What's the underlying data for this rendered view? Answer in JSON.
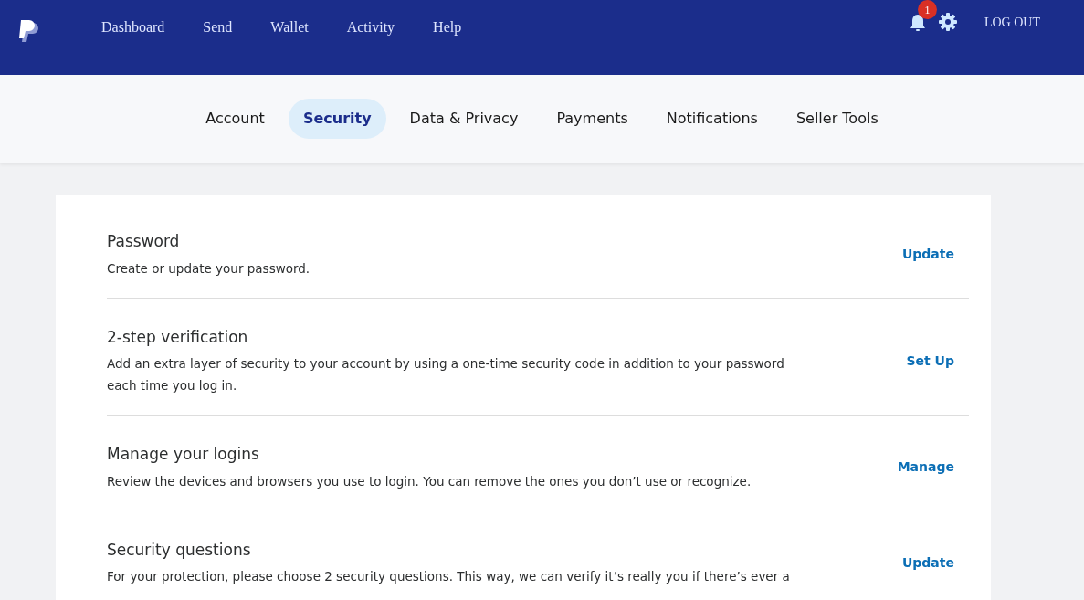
{
  "header": {
    "nav": [
      {
        "label": "Dashboard"
      },
      {
        "label": "Send"
      },
      {
        "label": "Wallet"
      },
      {
        "label": "Activity"
      },
      {
        "label": "Help"
      }
    ],
    "notification_count": "1",
    "logout": "LOG OUT"
  },
  "tabs": [
    {
      "label": "Account",
      "selected": false
    },
    {
      "label": "Security",
      "selected": true
    },
    {
      "label": "Data & Privacy",
      "selected": false
    },
    {
      "label": "Payments",
      "selected": false
    },
    {
      "label": "Notifications",
      "selected": false
    },
    {
      "label": "Seller Tools",
      "selected": false
    }
  ],
  "sections": [
    {
      "title": "Password",
      "description": "Create or update your password.",
      "action": "Update"
    },
    {
      "title": "2-step verification",
      "description": "Add an extra layer of security to your account by using a one-time security code in addition to your password each time you log in.",
      "action": "Set Up"
    },
    {
      "title": "Manage your logins",
      "description": "Review the devices and browsers you use to login. You can remove the ones you don’t use or recognize.",
      "action": "Manage"
    },
    {
      "title": "Security questions",
      "description": "For your protection, please choose 2 security questions. This way, we can verify it’s really you if there’s ever a",
      "action": "Update"
    }
  ]
}
